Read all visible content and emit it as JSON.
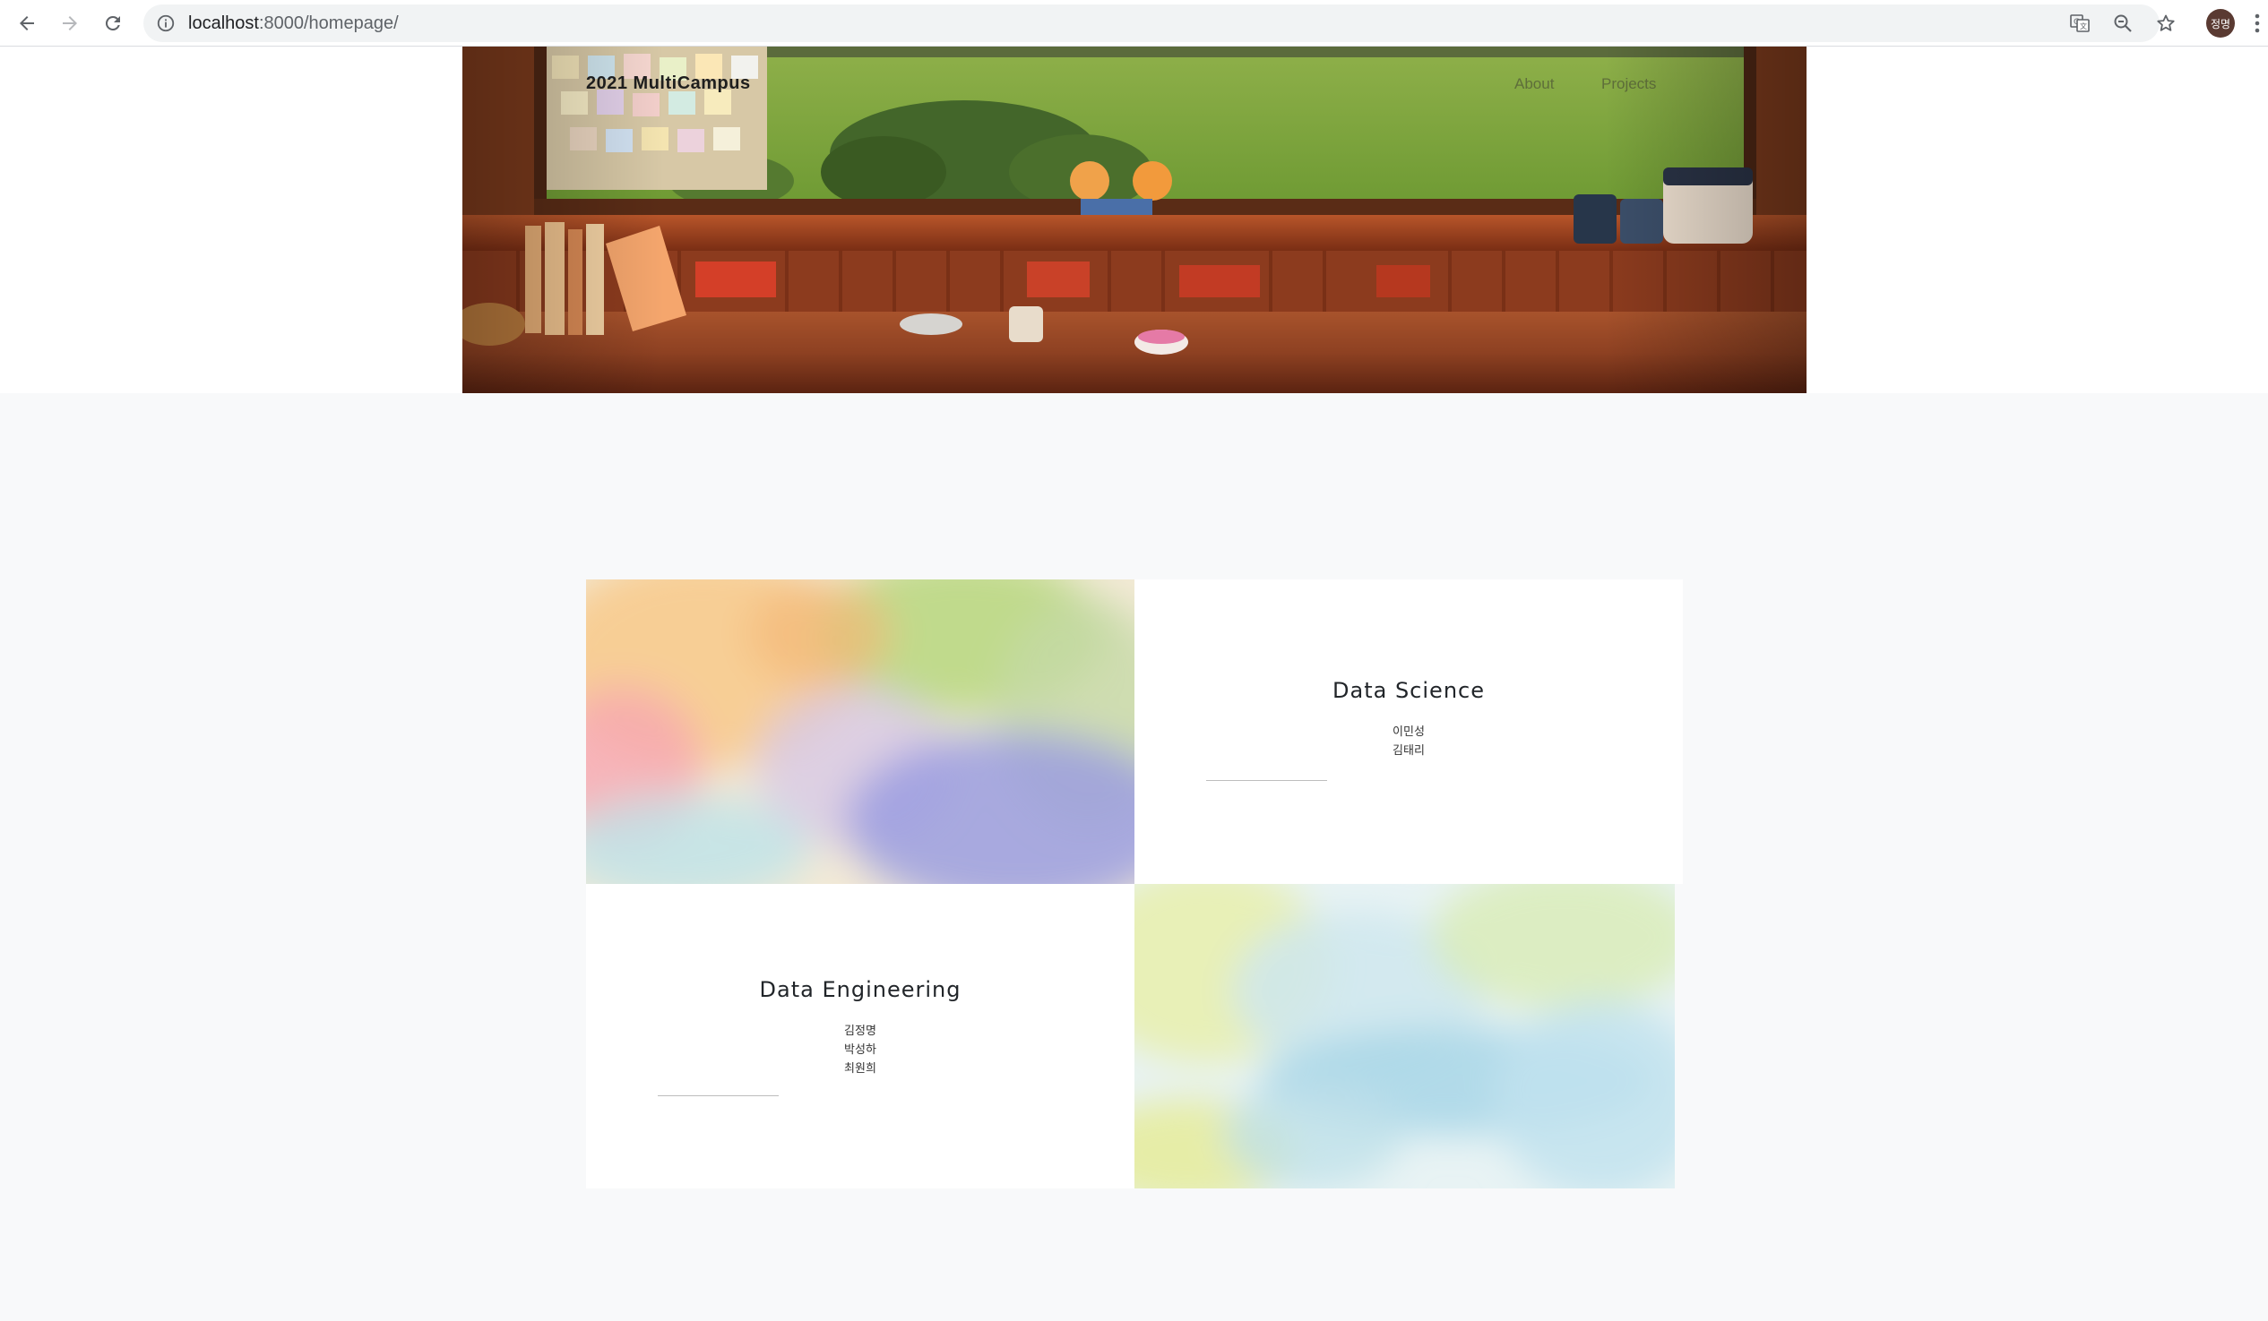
{
  "browser": {
    "url_host": "localhost",
    "url_rest": ":8000/homepage/",
    "profile_initials": "정명"
  },
  "header": {
    "brand": "2021 MultiCampus",
    "nav": [
      {
        "label": "About"
      },
      {
        "label": "Projects"
      }
    ]
  },
  "projects": [
    {
      "title": "Data Science",
      "members": [
        "이민성",
        "김태리"
      ]
    },
    {
      "title": "Data Engineering",
      "members": [
        "김정명",
        "박성하",
        "최원희"
      ]
    }
  ]
}
